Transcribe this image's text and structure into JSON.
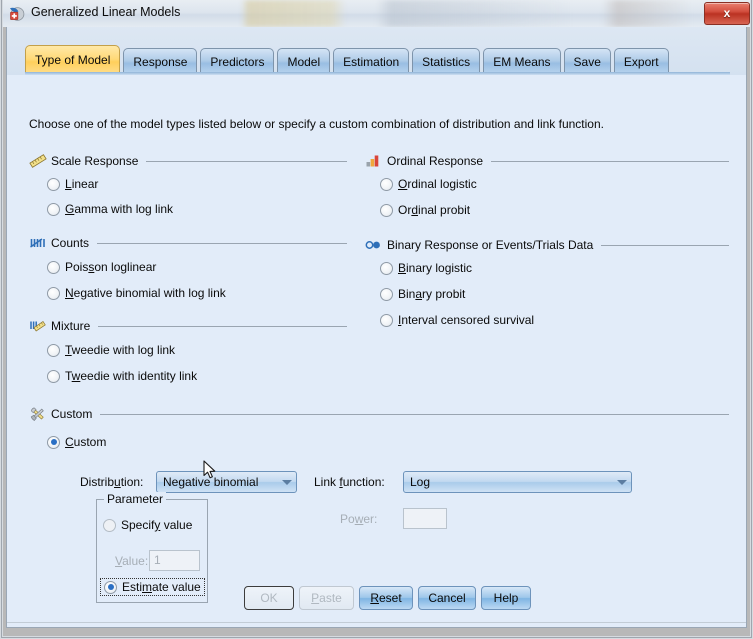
{
  "window": {
    "title": "Generalized Linear Models",
    "icon": "spss-app-icon",
    "close_label": "x"
  },
  "tabs": [
    {
      "label": "Type of Model",
      "active": true
    },
    {
      "label": "Response",
      "active": false
    },
    {
      "label": "Predictors",
      "active": false
    },
    {
      "label": "Model",
      "active": false
    },
    {
      "label": "Estimation",
      "active": false
    },
    {
      "label": "Statistics",
      "active": false
    },
    {
      "label": "EM Means",
      "active": false
    },
    {
      "label": "Save",
      "active": false
    },
    {
      "label": "Export",
      "active": false
    }
  ],
  "intro": "Choose one of the model types listed below or specify a custom combination of distribution and link function.",
  "sections": {
    "scale_response": {
      "title": "Scale Response",
      "icon": "ruler-icon",
      "options": [
        {
          "label": "Linear",
          "mnemonic": "L",
          "selected": false
        },
        {
          "label": "Gamma with log link",
          "mnemonic": "G",
          "selected": false
        }
      ]
    },
    "counts": {
      "title": "Counts",
      "icon": "tally-marks-icon",
      "options": [
        {
          "label": "Poisson loglinear",
          "mnemonic": "s",
          "selected": false
        },
        {
          "label": "Negative binomial with log link",
          "mnemonic": "N",
          "selected": false
        }
      ]
    },
    "mixture": {
      "title": "Mixture",
      "icon": "mixture-icon",
      "options": [
        {
          "label": "Tweedie with log link",
          "mnemonic": "T",
          "selected": false
        },
        {
          "label": "Tweedie with identity link",
          "mnemonic": "w",
          "selected": false
        }
      ]
    },
    "custom": {
      "title": "Custom",
      "icon": "tools-icon",
      "options": [
        {
          "label": "Custom",
          "mnemonic": "C",
          "selected": true
        }
      ]
    },
    "ordinal_response": {
      "title": "Ordinal Response",
      "icon": "bar-chart-icon",
      "options": [
        {
          "label": "Ordinal logistic",
          "mnemonic": "O",
          "selected": false
        },
        {
          "label": "Ordinal probit",
          "mnemonic": "d",
          "selected": false
        }
      ]
    },
    "binary_response": {
      "title": "Binary Response or Events/Trials Data",
      "icon": "binary-dots-icon",
      "options": [
        {
          "label": "Binary logistic",
          "mnemonic": "B",
          "selected": false
        },
        {
          "label": "Binary probit",
          "mnemonic": "a",
          "selected": false
        },
        {
          "label": "Interval censored survival",
          "mnemonic": "I",
          "selected": false
        }
      ]
    }
  },
  "custom_panel": {
    "distribution_label": "Distribution:",
    "distribution_value": "Negative binomial",
    "link_function_label": "Link function:",
    "link_function_value": "Log",
    "power_label": "Power:",
    "power_value": "",
    "power_enabled": false,
    "parameter_group": {
      "title": "Parameter",
      "specify_label": "Specify value",
      "specify_selected": false,
      "value_label": "Value:",
      "value_text": "1",
      "value_enabled": false,
      "estimate_label": "Estimate value",
      "estimate_selected": true,
      "estimate_focused": true
    }
  },
  "buttons": [
    {
      "label": "OK",
      "enabled": false,
      "default": true
    },
    {
      "label": "Paste",
      "enabled": false,
      "default": false
    },
    {
      "label": "Reset",
      "enabled": true,
      "default": false
    },
    {
      "label": "Cancel",
      "enabled": true,
      "default": false
    },
    {
      "label": "Help",
      "enabled": true,
      "default": false
    }
  ],
  "colors": {
    "dialog_bg": "#e2ecf9",
    "active_tab": "#ffd978",
    "tab_bg": "#a9cbe6",
    "accent_blue": "#2a6fc4",
    "close_red": "#bb3222"
  }
}
